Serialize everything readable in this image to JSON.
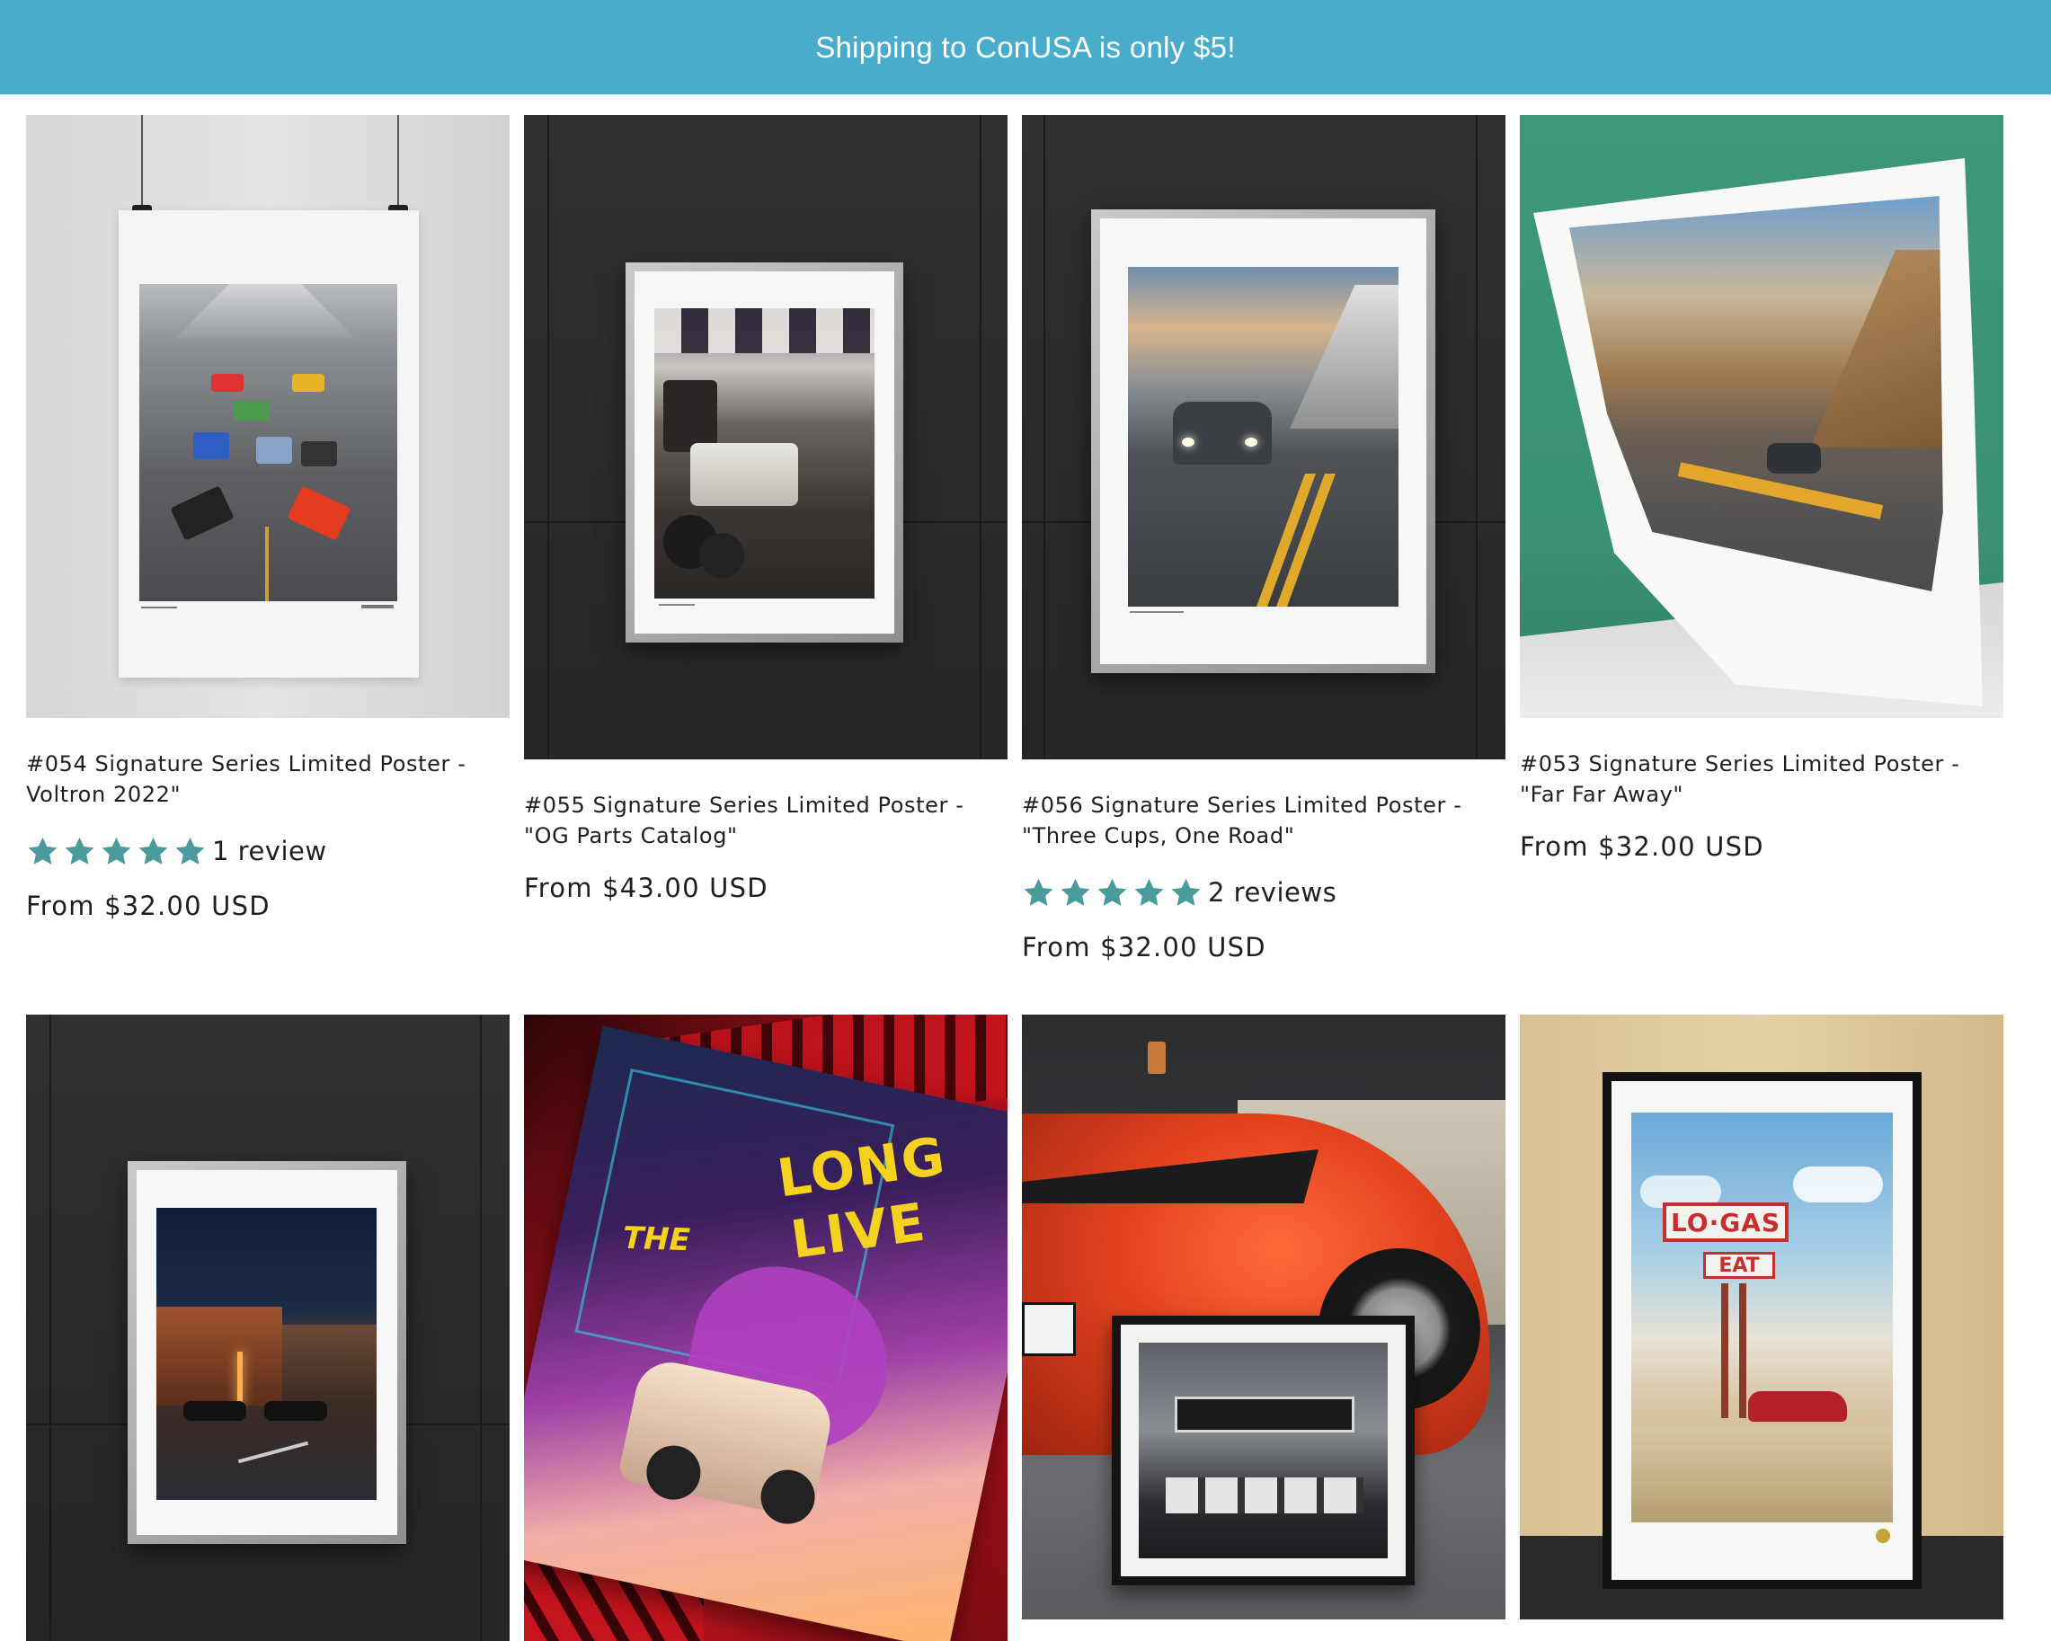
{
  "announcement": {
    "text": "Shipping to ConUSA is only $5!"
  },
  "colors": {
    "announcement_bg": "#4aaccb",
    "star": "#4a9b9b"
  },
  "products": [
    {
      "title": "#054 Signature Series Limited Poster - Voltron 2022\"",
      "rating": 5,
      "reviews": "1 review",
      "price": "From $32.00 USD"
    },
    {
      "title": "#055 Signature Series Limited Poster - \"OG Parts Catalog\"",
      "price": "From $43.00 USD"
    },
    {
      "title": "#056 Signature Series Limited Poster - \"Three Cups, One Road\"",
      "rating": 5,
      "reviews": "2 reviews",
      "price": "From $32.00 USD"
    },
    {
      "title": "#053 Signature Series Limited Poster - \"Far Far Away\"",
      "price": "From $32.00 USD"
    }
  ],
  "row2_images": [
    {
      "name": "framed-night-street-poster-image"
    },
    {
      "name": "long-live-the-80s-poster-image",
      "artwork_text": [
        "LONG",
        "LIVE",
        "THE"
      ]
    },
    {
      "name": "red-porsche-garage-poster-image"
    },
    {
      "name": "lo-gas-eat-poster-image",
      "artwork_text": [
        "LO·GAS",
        "EAT"
      ]
    }
  ]
}
